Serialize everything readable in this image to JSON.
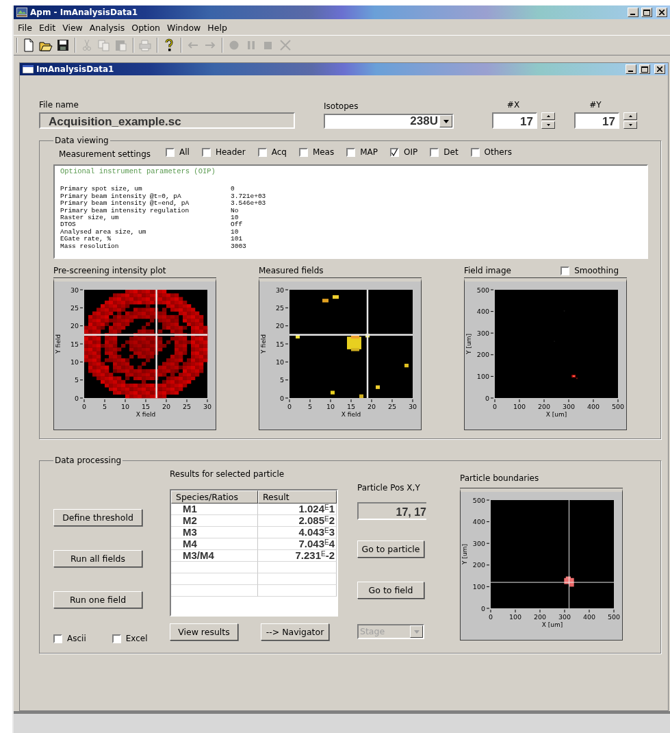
{
  "window": {
    "title": "Apm - ImAnalysisData1"
  },
  "menu": [
    "File",
    "Edit",
    "View",
    "Analysis",
    "Option",
    "Window",
    "Help"
  ],
  "toolbar_groups": [
    [
      {
        "kind": "new",
        "disabled": false
      },
      {
        "kind": "open",
        "disabled": false
      },
      {
        "kind": "save",
        "disabled": false
      }
    ],
    [
      {
        "kind": "cut",
        "disabled": true
      },
      {
        "kind": "copy",
        "disabled": true
      },
      {
        "kind": "paste",
        "disabled": true
      }
    ],
    [
      {
        "kind": "print",
        "disabled": true
      }
    ],
    [
      {
        "kind": "help",
        "disabled": false
      }
    ],
    [
      {
        "kind": "back",
        "disabled": true
      },
      {
        "kind": "forward",
        "disabled": true
      }
    ],
    [
      {
        "kind": "record",
        "disabled": true
      },
      {
        "kind": "pause",
        "disabled": true
      },
      {
        "kind": "stop",
        "disabled": true
      },
      {
        "kind": "cancel",
        "disabled": true
      }
    ]
  ],
  "document": {
    "title": "ImAnalysisData1"
  },
  "file_name": {
    "label": "File name",
    "value": "Acquisition_example.sc"
  },
  "isotopes": {
    "label": "Isotopes",
    "value": "238U"
  },
  "spinners": [
    {
      "label": "#X",
      "value": "17"
    },
    {
      "label": "#Y",
      "value": "17"
    }
  ],
  "data_viewing": {
    "title": "Data viewing",
    "settings_label": "Measurement settings",
    "options": [
      {
        "label": "All",
        "checked": false
      },
      {
        "label": "Header",
        "checked": false
      },
      {
        "label": "Acq",
        "checked": false
      },
      {
        "label": "Meas",
        "checked": false
      },
      {
        "label": "MAP",
        "checked": false
      },
      {
        "label": "OIP",
        "checked": true
      },
      {
        "label": "Det",
        "checked": false
      },
      {
        "label": "Others",
        "checked": false
      }
    ],
    "parameters": {
      "heading": "Optional instrument parameters (OIP)",
      "rows": [
        {
          "name": "Primary spot size, um",
          "value": "0"
        },
        {
          "name": "Primary beam intensity @t=0, pA",
          "value": "3.721e+03"
        },
        {
          "name": "Primary beam intensity @t=end, pA",
          "value": "3.546e+03"
        },
        {
          "name": "Primary beam intensity regulation",
          "value": "No"
        },
        {
          "name": "Raster size, um",
          "value": "10"
        },
        {
          "name": "DTOS",
          "value": "Off"
        },
        {
          "name": "Analysed area size, um",
          "value": "10"
        },
        {
          "name": "EGate rate, %",
          "value": "101"
        },
        {
          "name": "Mass resolution",
          "value": "3003"
        }
      ]
    },
    "plots": [
      {
        "title": "Pre-screening intensity plot",
        "kind": "ring",
        "xlabel": "X field",
        "ylabel": "Y field",
        "xticks": [
          "0",
          "5",
          "10",
          "15",
          "20",
          "25",
          "30"
        ],
        "yticks": [
          "30",
          "25",
          "20",
          "15",
          "10",
          "5",
          "0"
        ]
      },
      {
        "title": "Measured fields",
        "kind": "fields",
        "xlabel": "X field",
        "ylabel": "Y field",
        "xticks": [
          "0",
          "5",
          "10",
          "15",
          "20",
          "25",
          "30"
        ],
        "yticks": [
          "30",
          "25",
          "20",
          "15",
          "10",
          "5",
          "0"
        ]
      },
      {
        "title": "Field image",
        "kind": "spot",
        "xlabel": "X [um]",
        "ylabel": "Y [um]",
        "xticks": [
          "0",
          "100",
          "200",
          "300",
          "400",
          "500"
        ],
        "yticks": [
          "500",
          "400",
          "300",
          "200",
          "100",
          "0"
        ]
      }
    ],
    "smoothing": {
      "label": "Smoothing",
      "checked": false
    }
  },
  "data_processing": {
    "title": "Data processing",
    "actions": [
      "Define threshold",
      "Run all fields",
      "Run one field"
    ],
    "exports": [
      {
        "label": "Ascii",
        "checked": false
      },
      {
        "label": "Excel",
        "checked": false
      }
    ],
    "results": {
      "title": "Results for selected particle",
      "columns": [
        "Species/Ratios",
        "Result"
      ],
      "rows": [
        {
          "species": "M1",
          "result": "1.024$^{E}$1"
        },
        {
          "species": "M2",
          "result": "2.085$^{E}$2"
        },
        {
          "species": "M3",
          "result": "4.043$^{E}$3"
        },
        {
          "species": "M4",
          "result": "7.043$^{E}$4"
        },
        {
          "species": "M3/M4",
          "result": "7.231$^{E}$-2"
        }
      ]
    },
    "table_buttons": [
      "View results",
      "--> Navigator"
    ],
    "position": {
      "label": "Particle Pos X,Y",
      "value": "17, 17"
    },
    "nav_buttons": [
      "Go to particle",
      "Go to field"
    ],
    "stage": {
      "value": "Stage",
      "disabled": true
    },
    "boundaries": {
      "title": "Particle boundaries",
      "kind": "boundary",
      "xlabel": "X [um]",
      "ylabel": "Y [um]",
      "xticks": [
        "0",
        "100",
        "200",
        "300",
        "400",
        "500"
      ],
      "yticks": [
        "500",
        "400",
        "300",
        "200",
        "100",
        "0"
      ]
    }
  }
}
